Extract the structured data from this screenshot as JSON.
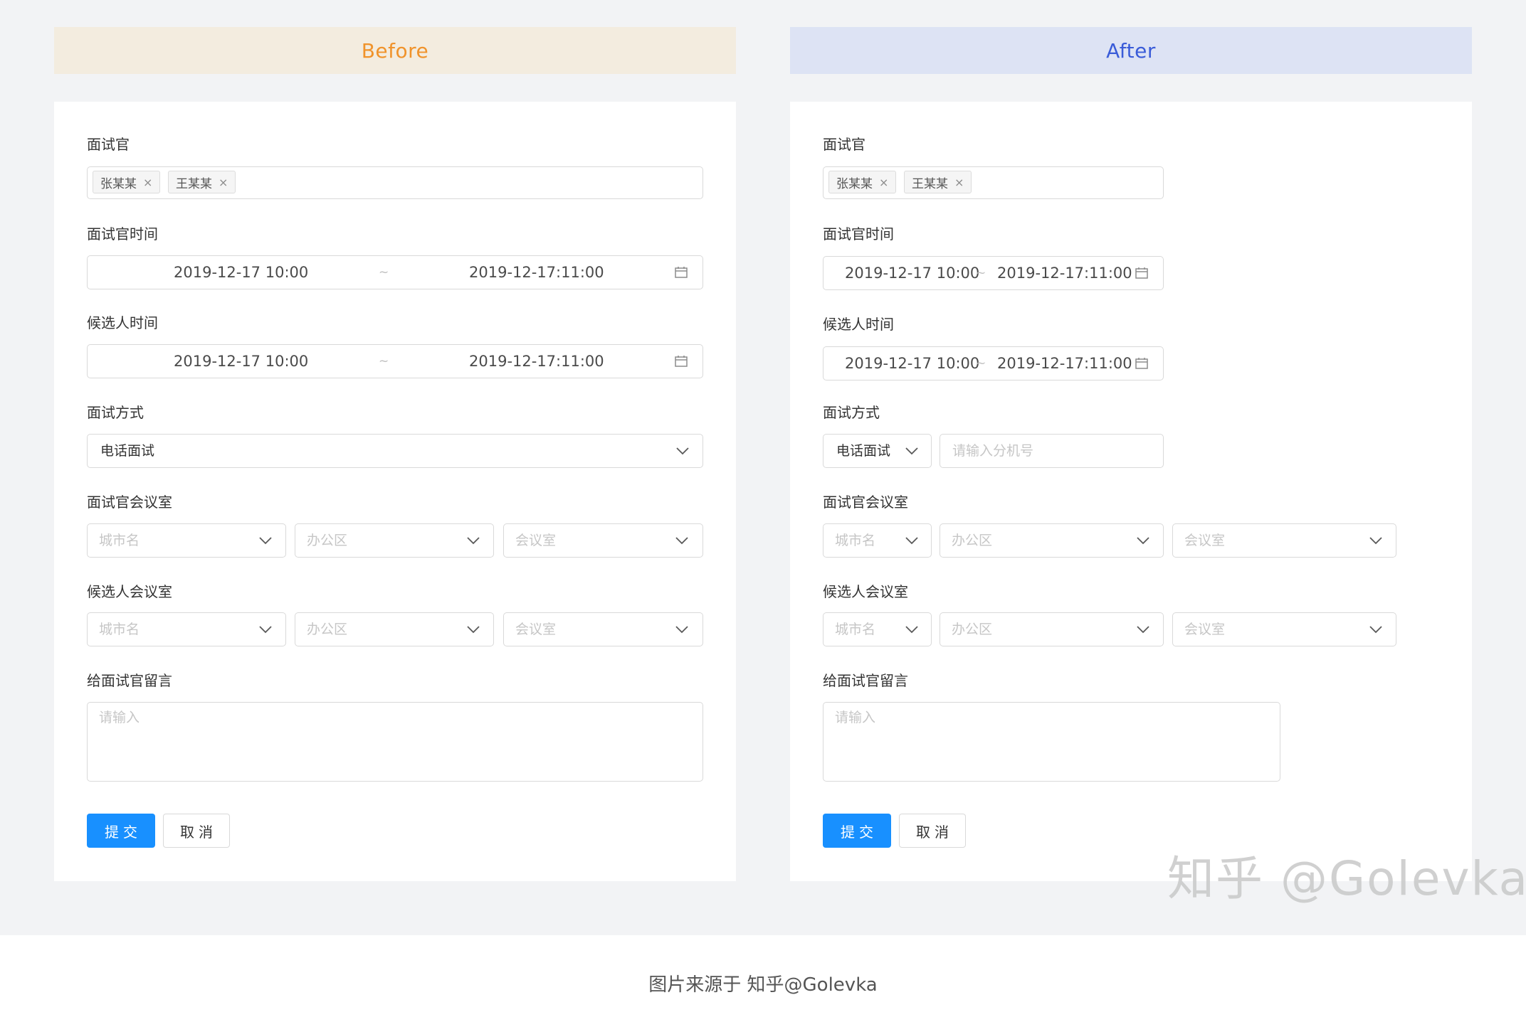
{
  "before": {
    "banner": "Before",
    "interviewer": {
      "label": "面试官",
      "tags": [
        {
          "text": "张某某",
          "close": "×"
        },
        {
          "text": "王某某",
          "close": "×"
        }
      ]
    },
    "interviewer_time": {
      "label": "面试官时间",
      "start": "2019-12-17 10:00",
      "sep": "~",
      "end": "2019-12-17:11:00"
    },
    "candidate_time": {
      "label": "候选人时间",
      "start": "2019-12-17 10:00",
      "sep": "~",
      "end": "2019-12-17:11:00"
    },
    "method": {
      "label": "面试方式",
      "value": "电话面试"
    },
    "interviewer_room": {
      "label": "面试官会议室",
      "city": "城市名",
      "office": "办公区",
      "room": "会议室"
    },
    "candidate_room": {
      "label": "候选人会议室",
      "city": "城市名",
      "office": "办公区",
      "room": "会议室"
    },
    "message": {
      "label": "给面试官留言",
      "placeholder": "请输入"
    },
    "submit": "提交",
    "cancel": "取消"
  },
  "after": {
    "banner": "After",
    "interviewer": {
      "label": "面试官",
      "tags": [
        {
          "text": "张某某",
          "close": "×"
        },
        {
          "text": "王某某",
          "close": "×"
        }
      ]
    },
    "interviewer_time": {
      "label": "面试官时间",
      "start": "2019-12-17 10:00",
      "sep": "~",
      "end": "2019-12-17:11:00"
    },
    "candidate_time": {
      "label": "候选人时间",
      "start": "2019-12-17 10:00",
      "sep": "~",
      "end": "2019-12-17:11:00"
    },
    "method": {
      "label": "面试方式",
      "value": "电话面试",
      "extension_placeholder": "请输入分机号"
    },
    "interviewer_room": {
      "label": "面试官会议室",
      "city": "城市名",
      "office": "办公区",
      "room": "会议室"
    },
    "candidate_room": {
      "label": "候选人会议室",
      "city": "城市名",
      "office": "办公区",
      "room": "会议室"
    },
    "message": {
      "label": "给面试官留言",
      "placeholder": "请输入"
    },
    "submit": "提交",
    "cancel": "取消"
  },
  "watermark": "知乎 @Golevka",
  "caption": "图片来源于 知乎@Golevka",
  "icons": {
    "dropdown": "chevron-down-icon",
    "date": "calendar-icon",
    "tag_close": "close-icon"
  },
  "colors": {
    "before_banner_bg": "#f3ecdf",
    "before_banner_text": "#f0932b",
    "after_banner_bg": "#dde3f4",
    "after_banner_text": "#3a5cd8",
    "primary": "#1890ff",
    "page_bg": "#f2f3f5"
  }
}
